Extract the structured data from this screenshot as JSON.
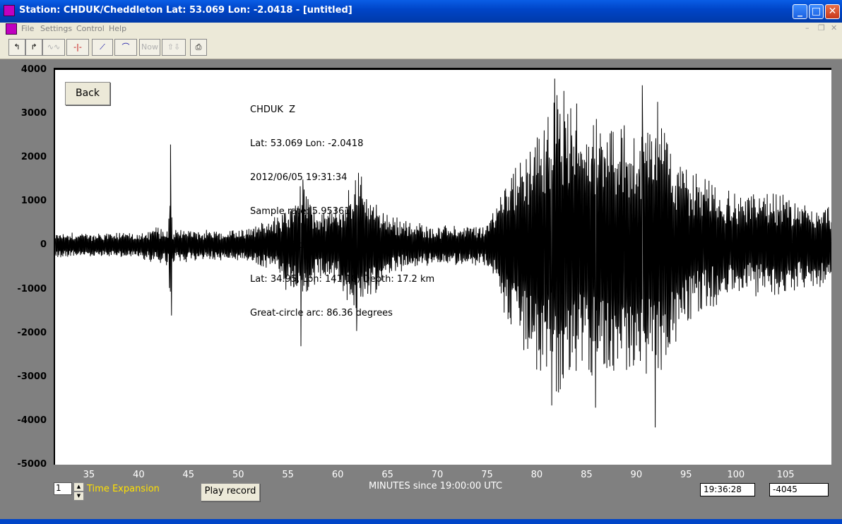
{
  "window": {
    "title": "Station: CHDUK/Cheddleton Lat: 53.069 Lon: -2.0418 - [untitled]"
  },
  "menu": [
    "File",
    "Settings",
    "Control",
    "Help"
  ],
  "toolbar": {
    "now_label": "Now"
  },
  "plot": {
    "back_label": "Back",
    "info_lines": [
      "CHDUK  Z",
      "Lat: 53.069 Lon: -2.0418",
      "2012/06/05 19:31:34",
      "Sample rate: 5.95361",
      "Multiple filters applied",
      "Lat: 34.95, Lon: 141.18, Depth: 17.2 km",
      "Great-circle arc: 86.36 degrees"
    ]
  },
  "chart_data": {
    "type": "line",
    "xlabel": "MINUTES since 19:00:00 UTC",
    "ylabel": "",
    "xlim": [
      31.6,
      109.6
    ],
    "ylim": [
      -5000,
      4000
    ],
    "x_ticks": [
      "35",
      "40",
      "45",
      "50",
      "55",
      "60",
      "65",
      "70",
      "75",
      "80",
      "85",
      "90",
      "95",
      "100",
      "105"
    ],
    "y_ticks": [
      "4000",
      "3000",
      "2000",
      "1000",
      "0",
      "-1000",
      "-2000",
      "-3000",
      "-4000",
      "-5000"
    ],
    "series": [
      {
        "name": "",
        "x_start": 31.6,
        "x_end": 109.6,
        "envelope": [
          [
            31.6,
            300
          ],
          [
            40,
            300
          ],
          [
            43,
            500
          ],
          [
            43.2,
            2300
          ],
          [
            43.4,
            400
          ],
          [
            50,
            350
          ],
          [
            54,
            700
          ],
          [
            55,
            1200
          ],
          [
            56.5,
            1500
          ],
          [
            58,
            800
          ],
          [
            60,
            900
          ],
          [
            62,
            1800
          ],
          [
            65,
            700
          ],
          [
            70,
            450
          ],
          [
            75,
            500
          ],
          [
            77,
            1800
          ],
          [
            79,
            2600
          ],
          [
            81,
            3200
          ],
          [
            82,
            3800
          ],
          [
            84,
            3300
          ],
          [
            86,
            3000
          ],
          [
            88,
            3300
          ],
          [
            90,
            2900
          ],
          [
            92,
            3700
          ],
          [
            93,
            2800
          ],
          [
            95,
            1800
          ],
          [
            100,
            1200
          ],
          [
            104,
            1200
          ],
          [
            109.6,
            900
          ]
        ],
        "spikes": [
          [
            43.2,
            2300
          ],
          [
            43.3,
            -1600
          ],
          [
            56.3,
            -2300
          ],
          [
            56.5,
            1500
          ],
          [
            61.9,
            1900
          ],
          [
            61.9,
            -1950
          ],
          [
            81.8,
            3800
          ],
          [
            81.5,
            -3650
          ],
          [
            85.9,
            -3700
          ],
          [
            91.9,
            -4150
          ],
          [
            90.6,
            3650
          ]
        ]
      }
    ]
  },
  "bottom": {
    "time_expansion_value": "1",
    "time_expansion_label": "Time Expansion",
    "play_label": "Play record",
    "time_readout": "19:36:28",
    "value_readout": "-4045"
  }
}
